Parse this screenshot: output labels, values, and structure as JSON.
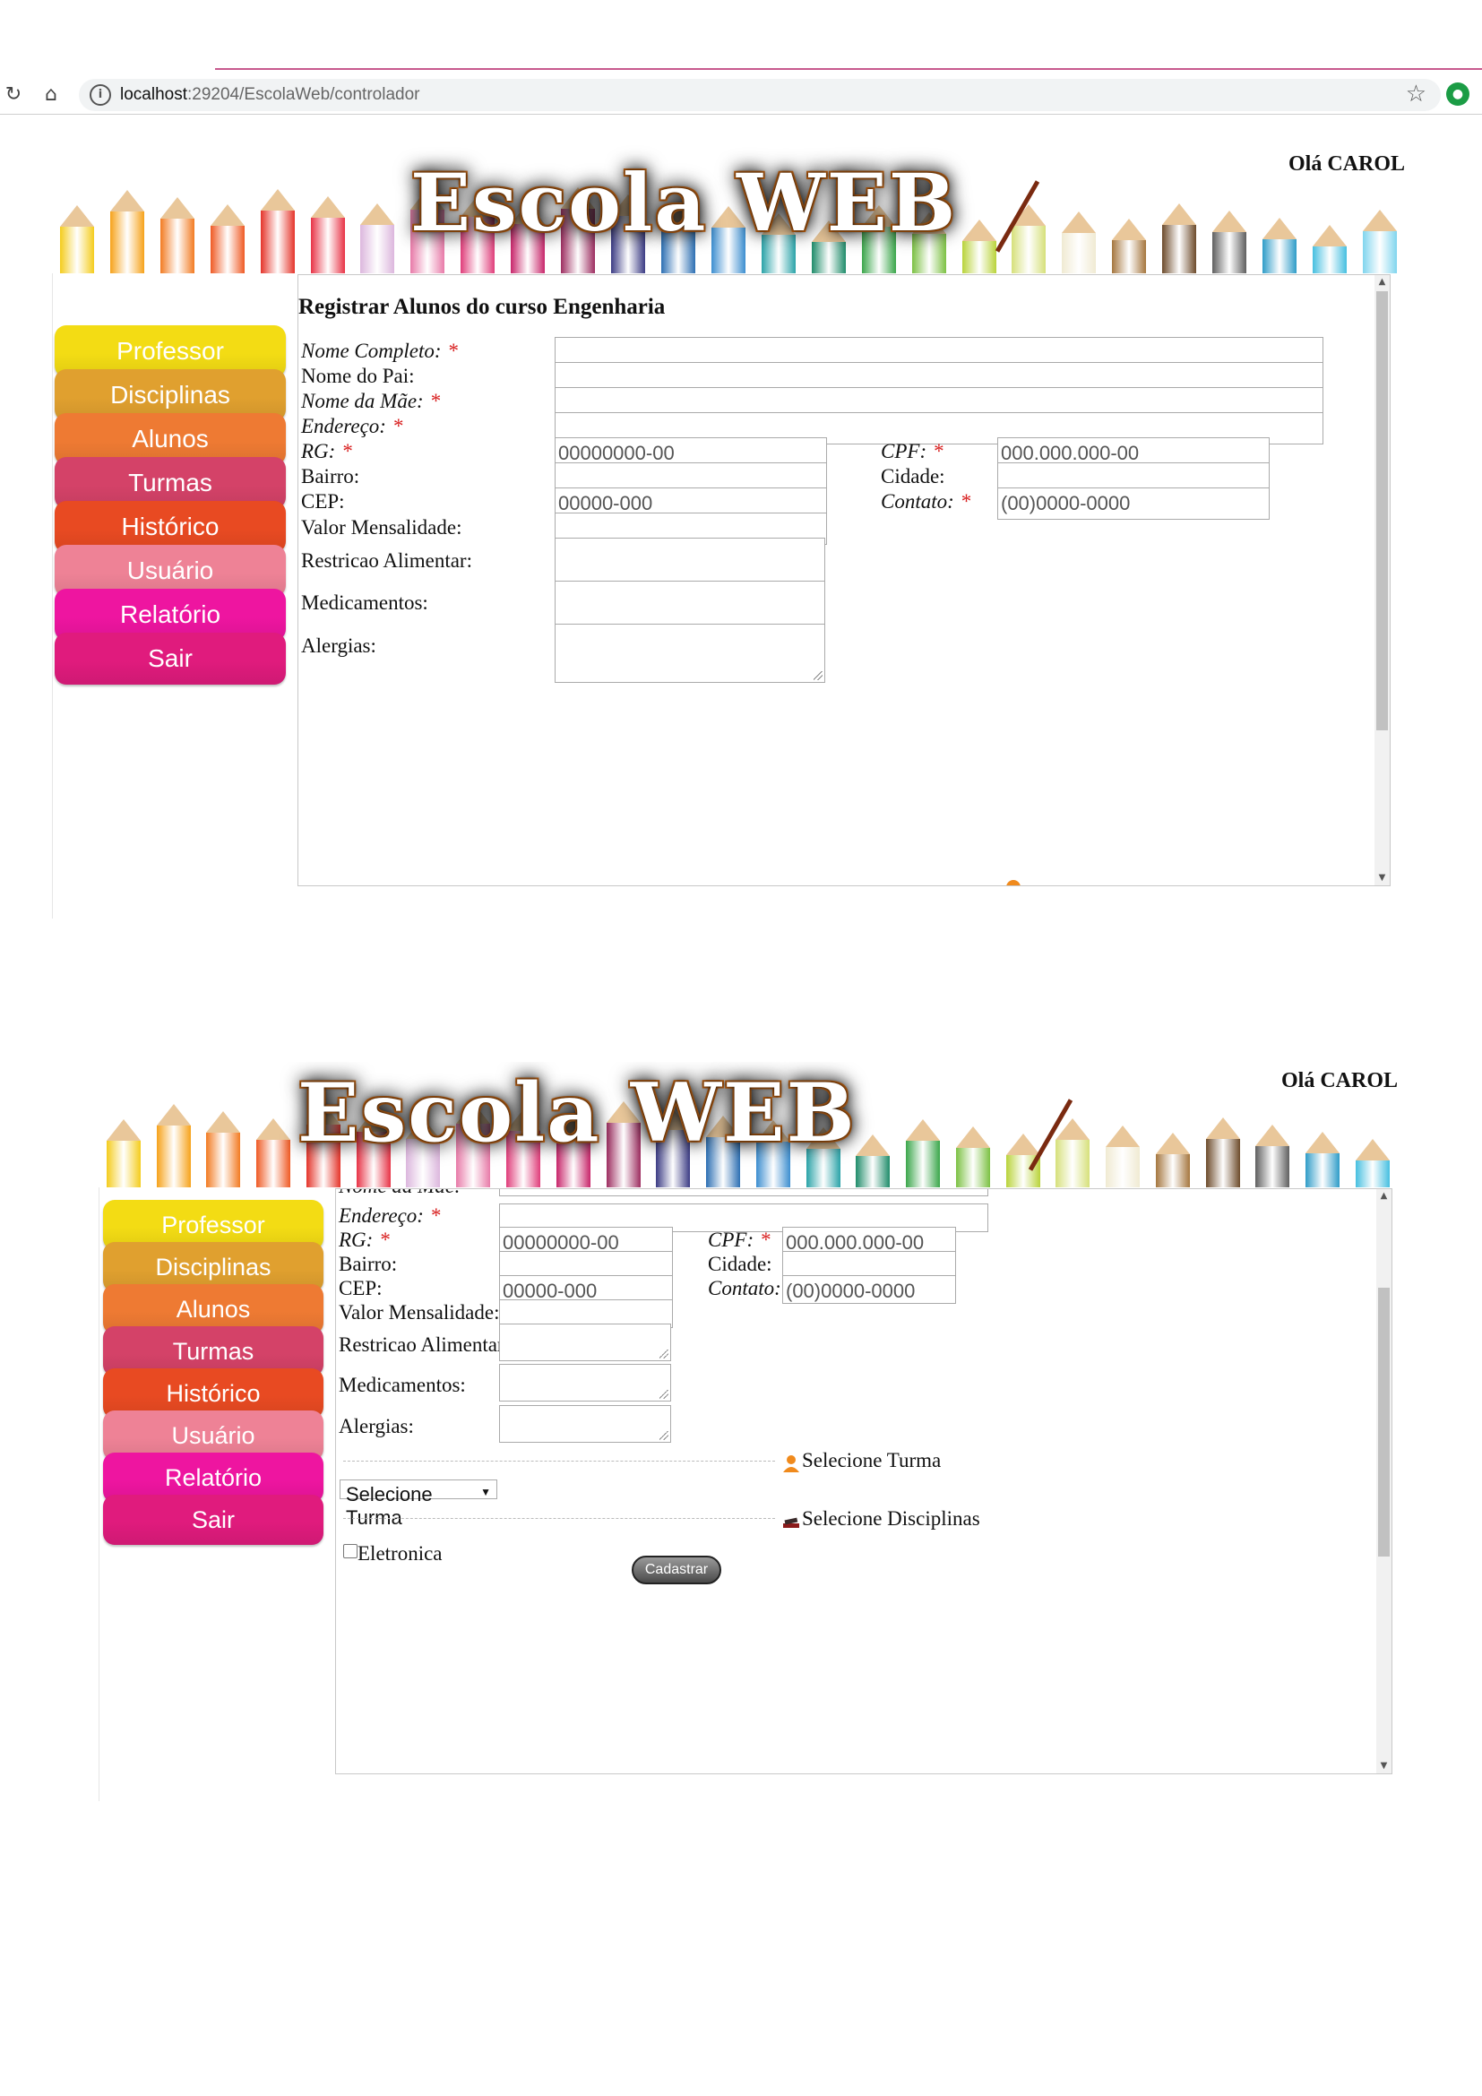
{
  "browser": {
    "url_host": "localhost",
    "url_rest": ":29204/EscolaWeb/controlador"
  },
  "header": {
    "logo": "Escola WEB",
    "greeting": "Olá CAROL"
  },
  "menu": [
    {
      "label": "Professor",
      "color": "#f3dc14"
    },
    {
      "label": "Disciplinas",
      "color": "#e0a02f"
    },
    {
      "label": "Alunos",
      "color": "#ee7a33"
    },
    {
      "label": "Turmas",
      "color": "#d44268"
    },
    {
      "label": "Histórico",
      "color": "#e84a22"
    },
    {
      "label": "Usuário",
      "color": "#ee8296"
    },
    {
      "label": "Relatório",
      "color": "#ee15a0"
    },
    {
      "label": "Sair",
      "color": "#e01b7d"
    }
  ],
  "form": {
    "title": "Registrar Alunos do curso Engenharia",
    "required_mark": "*",
    "nome_completo": "Nome Completo:",
    "nome_pai": "Nome do Pai:",
    "nome_mae": "Nome da Mãe:",
    "endereco": "Endereço:",
    "rg": "RG:",
    "rg_value": "00000000-00",
    "cpf": "CPF:",
    "cpf_value": "000.000.000-00",
    "bairro": "Bairro:",
    "cidade": "Cidade:",
    "cep": "CEP:",
    "cep_value": "00000-000",
    "contato": "Contato:",
    "contato_value": "(00)0000-0000",
    "valor_mensalidade": "Valor Mensalidade:",
    "restricao": "Restricao Alimentar:",
    "medicamentos": "Medicamentos:",
    "alergias": "Alergias:",
    "selecione_turma_section": "Selecione Turma",
    "selecione_turma_option": "Selecione Turma",
    "selecione_disciplinas_section": "Selecione Disciplinas",
    "disciplina_eletronica": "Eletronica",
    "submit": "Cadastrar"
  },
  "colors": {
    "required": "#d81e1e",
    "chrome_accent": "#c85a8e"
  },
  "icons": [
    "reload-icon",
    "home-icon",
    "info-icon",
    "star-icon",
    "extension-icon",
    "user-icon",
    "books-icon",
    "scroll-up-icon",
    "scroll-down-icon"
  ]
}
